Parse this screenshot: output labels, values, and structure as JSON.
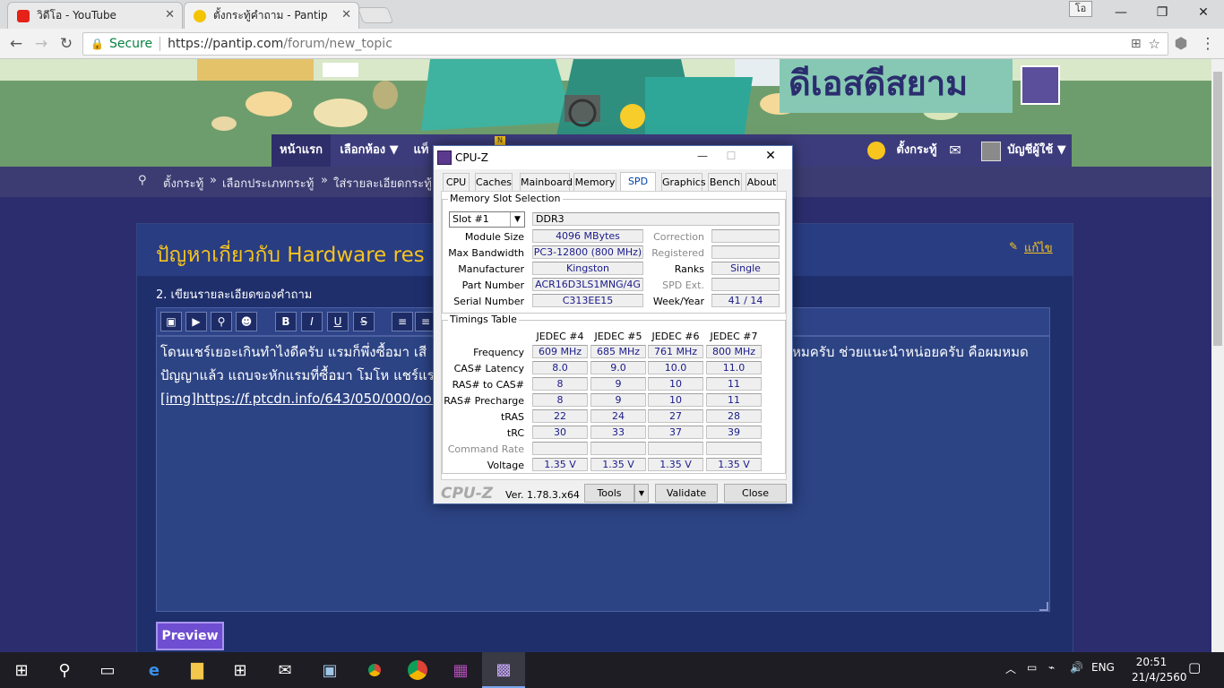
{
  "browser": {
    "tabs": [
      {
        "label": "วิดีโอ - YouTube"
      },
      {
        "label": "ตั้งกระทู้คำถาม - Pantip"
      }
    ],
    "user_label": "โอ",
    "secure_label": "Secure",
    "url_host": "https://pantip.com",
    "url_path": "/forum/new_topic"
  },
  "site": {
    "nav": {
      "home": "หน้าแรก",
      "rooms": "เลือกห้อง ▼",
      "tags": "แท็",
      "new_badge": "N",
      "create": "ตั้งกระทู้",
      "account": "บัญชีผู้ใช้ ▼"
    },
    "breadcrumb": {
      "step1": "ตั้งกระทู้",
      "step2": "เลือกประเภทกระทู้",
      "step3": "ใส่รายละเอียดกระทู้",
      "separator": "»"
    },
    "topic_title": "ปัญหาเกี่ยวกับ Hardware res",
    "edit_link": "แก้ไข",
    "question_label": "2. เขียนรายละเอียดของคำถาม",
    "editor_lines": [
      "โดนแชร์เยอะเกินทำไงดีครับ แรมก็พึ่งซื้อมา เสี",
      "ปัญญาแล้ว แถบจะหักแรมที่ซื้อมา โมโห แชร์แร",
      "[img]https://f.ptcdn.info/643/050/000/oori"
    ],
    "editor_line_right": "หมครับ ช่วยแนะนำหน่อยครับ คือผมหมด",
    "preview_button": "Preview",
    "toolbar_buttons": {
      "bold": "B",
      "italic": "I",
      "underline": "U",
      "strike": "S"
    }
  },
  "cpuz": {
    "title": "CPU-Z",
    "tabs": [
      "CPU",
      "Caches",
      "Mainboard",
      "Memory",
      "SPD",
      "Graphics",
      "Bench",
      "About"
    ],
    "selected_tab": "SPD",
    "slot_group_label": "Memory Slot Selection",
    "slot": "Slot #1",
    "memory_type": "DDR3",
    "fields": {
      "module_size_label": "Module Size",
      "module_size": "4096 MBytes",
      "max_bandwidth_label": "Max Bandwidth",
      "max_bandwidth": "PC3-12800 (800 MHz)",
      "manufacturer_label": "Manufacturer",
      "manufacturer": "Kingston",
      "part_number_label": "Part Number",
      "part_number": "ACR16D3LS1MNG/4G",
      "serial_number_label": "Serial Number",
      "serial_number": "C313EE15",
      "correction_label": "Correction",
      "registered_label": "Registered",
      "ranks_label": "Ranks",
      "ranks": "Single",
      "spd_ext_label": "SPD Ext.",
      "week_year_label": "Week/Year",
      "week_year": "41 / 14"
    },
    "timings": {
      "group_label": "Timings Table",
      "columns": [
        "JEDEC #4",
        "JEDEC #5",
        "JEDEC #6",
        "JEDEC #7"
      ],
      "rows": [
        {
          "label": "Frequency",
          "values": [
            "609 MHz",
            "685 MHz",
            "761 MHz",
            "800 MHz"
          ]
        },
        {
          "label": "CAS# Latency",
          "values": [
            "8.0",
            "9.0",
            "10.0",
            "11.0"
          ]
        },
        {
          "label": "RAS# to CAS#",
          "values": [
            "8",
            "9",
            "10",
            "11"
          ]
        },
        {
          "label": "RAS# Precharge",
          "values": [
            "8",
            "9",
            "10",
            "11"
          ]
        },
        {
          "label": "tRAS",
          "values": [
            "22",
            "24",
            "27",
            "28"
          ]
        },
        {
          "label": "tRC",
          "values": [
            "30",
            "33",
            "37",
            "39"
          ]
        },
        {
          "label": "Command Rate",
          "values": [
            "",
            "",
            "",
            ""
          ]
        },
        {
          "label": "Voltage",
          "values": [
            "1.35 V",
            "1.35 V",
            "1.35 V",
            "1.35 V"
          ]
        }
      ]
    },
    "brand": "CPU-Z",
    "version": "Ver. 1.78.3.x64",
    "buttons": {
      "tools": "Tools",
      "validate": "Validate",
      "close": "Close"
    }
  },
  "taskbar": {
    "language": "ENG",
    "time": "20:51",
    "date": "21/4/2560"
  }
}
